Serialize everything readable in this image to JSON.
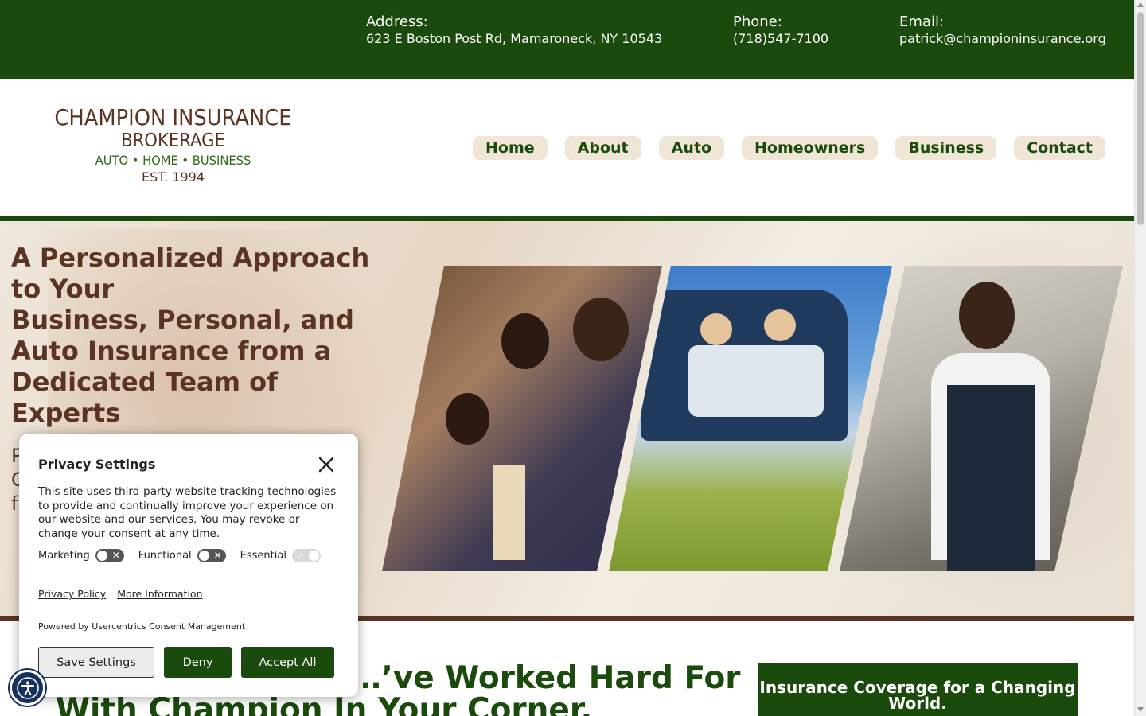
{
  "topbar": {
    "address_label": "Address:",
    "address_value": "623 E Boston Post Rd, Mamaroneck, NY 10543",
    "phone_label": "Phone:",
    "phone_value": "(718)547-7100",
    "email_label": "Email:",
    "email_value": "patrick@championinsurance.org"
  },
  "logo": {
    "line1": "CHAMPION INSURANCE",
    "line2": "BROKERAGE",
    "line3": "AUTO • HOME • BUSINESS",
    "line4": "EST. 1994"
  },
  "nav": {
    "items": [
      "Home",
      "About",
      "Auto",
      "Homeowners",
      "Business",
      "Contact"
    ]
  },
  "hero": {
    "heading_line1": "A Personalized Approach to Your",
    "heading_line2": "Business, Personal, and Auto Insurance from a Dedicated Team of Experts",
    "sub_fragment": "P\nC\nf"
  },
  "main": {
    "section_title_line1": "…’ve Worked Hard For",
    "section_title_line2": "With Champion In Your Corner.",
    "cta_title": "Insurance Coverage for a Changing World."
  },
  "privacy": {
    "title": "Privacy Settings",
    "text": "This site uses third-party website tracking technologies to provide and continually improve your experience on our website and our services. You may revoke or change your consent at any time.",
    "toggles": [
      "Marketing",
      "Functional",
      "Essential"
    ],
    "policy_link": "Privacy Policy",
    "more_link": "More Information",
    "powered_by": "Powered by Usercentrics Consent Management",
    "save_label": "Save Settings",
    "deny_label": "Deny",
    "accept_label": "Accept All"
  },
  "colors": {
    "brand_green": "#1a4a0c",
    "brand_brown": "#5a3323",
    "nav_pill_bg": "#efe6d5"
  }
}
